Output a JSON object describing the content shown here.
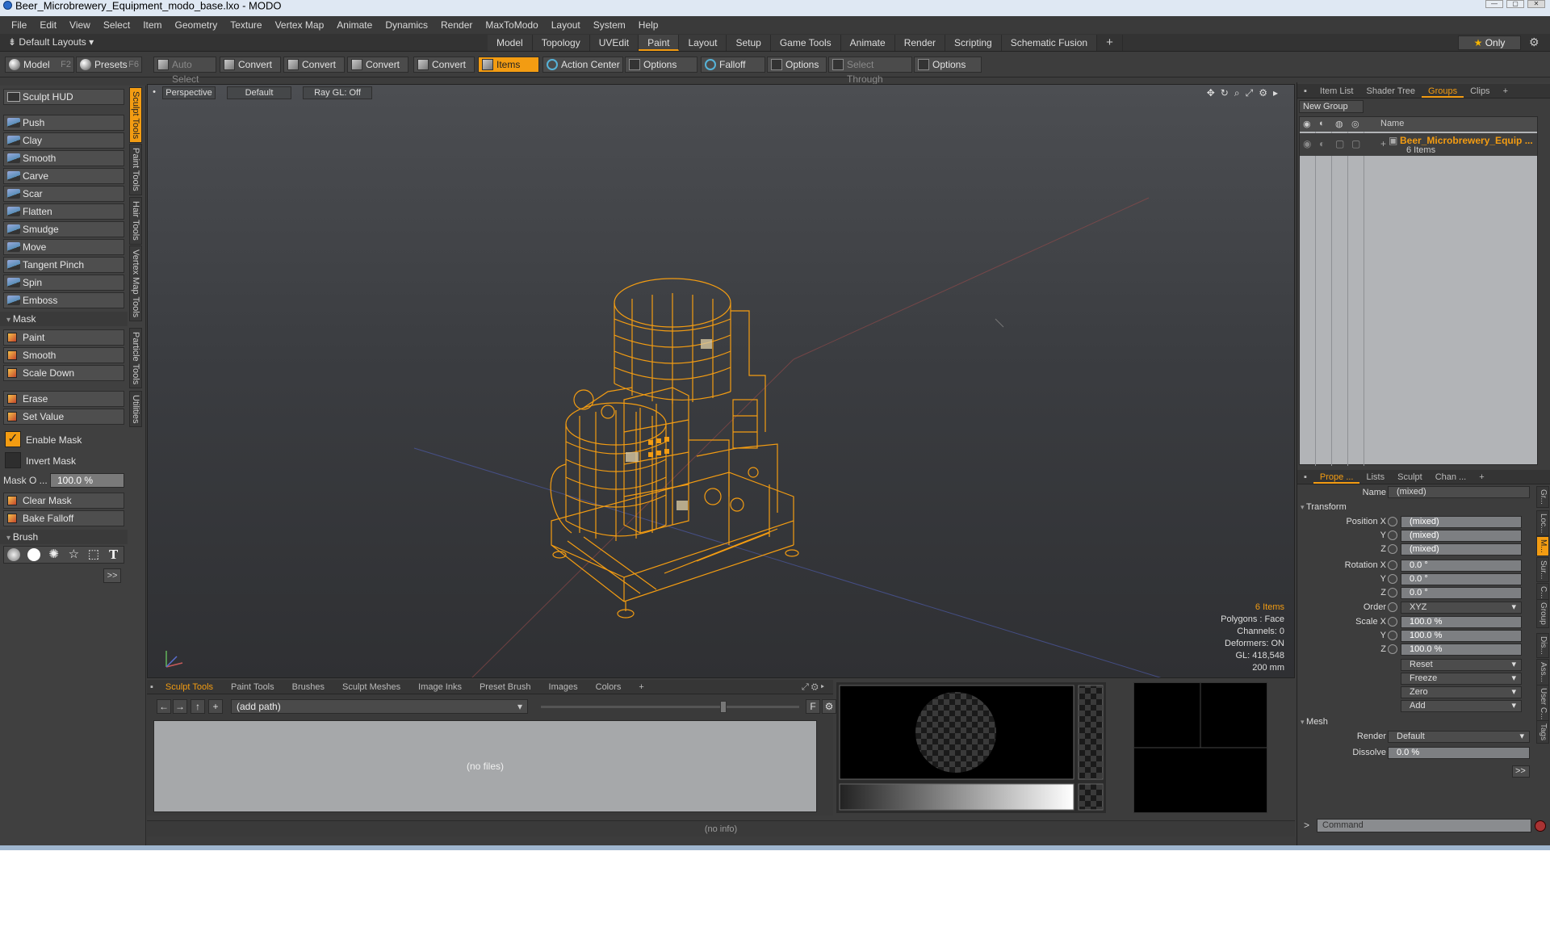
{
  "title": "Beer_Microbrewery_Equipment_modo_base.lxo - MODO",
  "menu": [
    "File",
    "Edit",
    "View",
    "Select",
    "Item",
    "Geometry",
    "Texture",
    "Vertex Map",
    "Animate",
    "Dynamics",
    "Render",
    "MaxToModo",
    "Layout",
    "System",
    "Help"
  ],
  "layout": {
    "selector": "Default Layouts",
    "tabs": [
      "Model",
      "Topology",
      "UVEdit",
      "Paint",
      "Layout",
      "Setup",
      "Game Tools",
      "Animate",
      "Render",
      "Scripting",
      "Schematic Fusion"
    ],
    "active_tab": "Paint",
    "only_label": "Only"
  },
  "toolbar": {
    "model_label": "Model",
    "model_key": "F2",
    "presets_label": "Presets",
    "presets_key": "F6",
    "auto_select": "Auto Select",
    "convert_label": "Convert",
    "items_label": "Items",
    "action_center": "Action Center",
    "options": "Options",
    "falloff": "Falloff",
    "select_through": "Select Through"
  },
  "left_panel": {
    "sculpt_hud": "Sculpt HUD",
    "tools": [
      "Push",
      "Clay",
      "Smooth",
      "Carve",
      "Scar",
      "Flatten",
      "Smudge",
      "Move",
      "Tangent Pinch",
      "Spin",
      "Emboss"
    ],
    "mask_section": "Mask",
    "mask_tools": [
      "Paint",
      "Smooth",
      "Scale Down"
    ],
    "erase": "Erase",
    "set_value": "Set Value",
    "enable_mask": "Enable Mask",
    "invert_mask": "Invert Mask",
    "mask_opacity_label": "Mask O ...",
    "mask_opacity_value": "100.0 %",
    "clear_mask": "Clear Mask",
    "bake_falloff": "Bake Falloff",
    "brush_section": "Brush",
    "more": ">>",
    "vertical_tabs": [
      "Sculpt Tools",
      "Paint Tools",
      "Hair Tools",
      "Vertex Map Tools",
      "Particle Tools",
      "Utilities"
    ]
  },
  "viewport": {
    "perspective": "Perspective",
    "default": "Default",
    "raygl": "Ray GL: Off",
    "stats": {
      "items": "6 Items",
      "polygons": "Polygons : Face",
      "channels": "Channels: 0",
      "deformers": "Deformers: ON",
      "gl": "GL: 418,548",
      "scale": "200 mm"
    },
    "model_color": "#f39c12"
  },
  "bottom": {
    "tabs": [
      "Sculpt Tools",
      "Paint Tools",
      "Brushes",
      "Sculpt Meshes",
      "Image Inks",
      "Preset Brush",
      "Images",
      "Colors"
    ],
    "active_tab": "Sculpt Tools",
    "path": "(add path)",
    "no_files": "(no files)",
    "f_label": "F"
  },
  "info": "(no info)",
  "right_panel": {
    "top_tabs": [
      "Item List",
      "Shader Tree",
      "Groups",
      "Clips"
    ],
    "active_top_tab": "Groups",
    "new_group": "New Group",
    "name_header": "Name",
    "group_name": "Beer_Microbrewery_Equip ...",
    "group_count": "6 Items",
    "prop_tabs": [
      "Prope ...",
      "Lists",
      "Sculpt",
      "Chan ..."
    ],
    "name_label": "Name",
    "name_value": "(mixed)",
    "transform": "Transform",
    "position_x_label": "Position X",
    "y_label": "Y",
    "z_label": "Z",
    "rotation_x_label": "Rotation X",
    "order_label": "Order",
    "scale_x_label": "Scale X",
    "position": [
      "(mixed)",
      "(mixed)",
      "(mixed)"
    ],
    "rotation": [
      "0.0 °",
      "0.0 °",
      "0.0 °"
    ],
    "order": "XYZ",
    "scale": [
      "100.0 %",
      "100.0 %",
      "100.0 %"
    ],
    "actions": [
      "Reset",
      "Freeze",
      "Zero",
      "Add"
    ],
    "mesh": "Mesh",
    "render_label": "Render",
    "render_value": "Default",
    "dissolve_label": "Dissolve",
    "dissolve_value": "0.0 %",
    "more": ">>",
    "side_tabs": [
      "Gr...",
      "Loc...",
      "M...",
      "Sur...",
      "C...",
      "Group",
      "Dis...",
      "Ass...",
      "User C...",
      "Tags"
    ],
    "command_prompt": ">",
    "command_placeholder": "Command"
  }
}
